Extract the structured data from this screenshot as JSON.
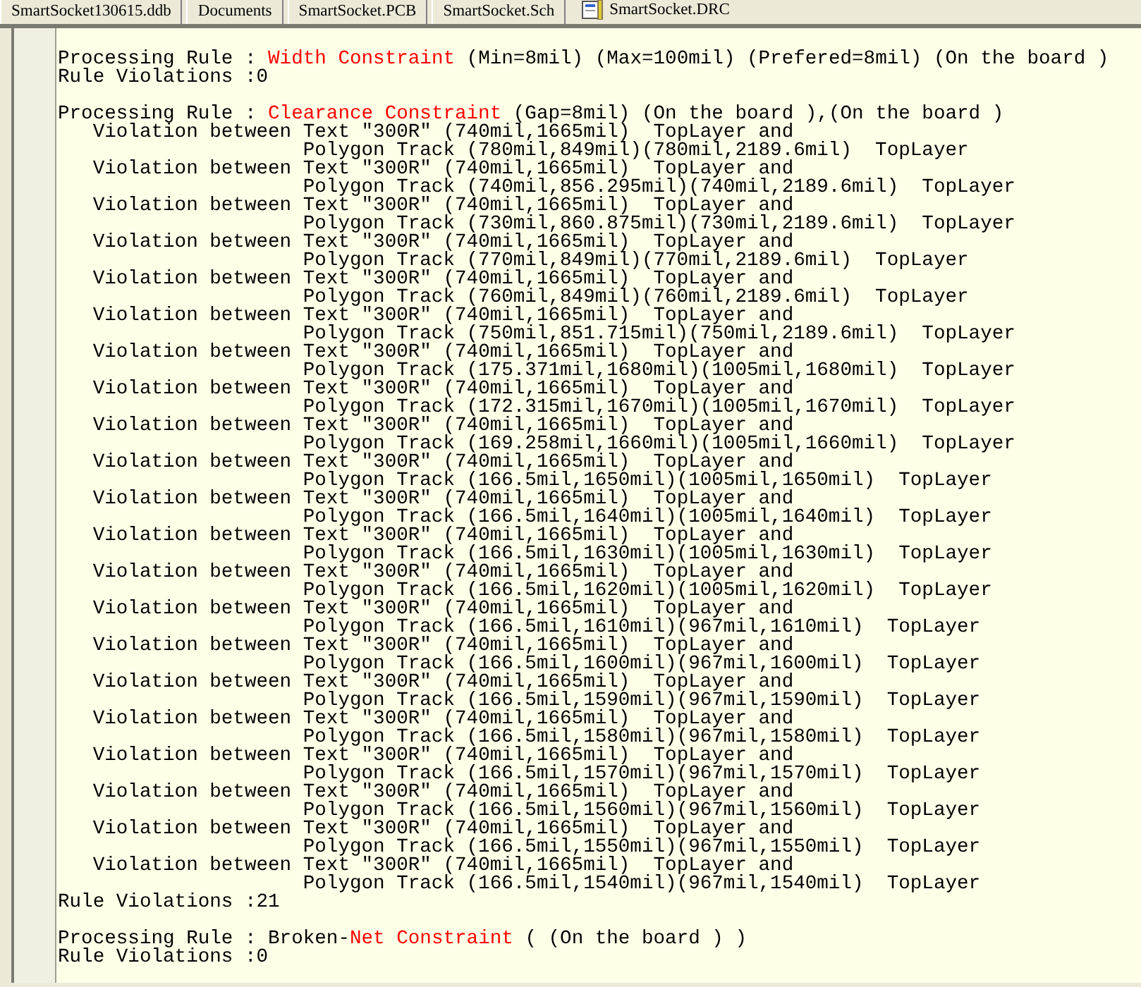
{
  "tabs": [
    {
      "label": "SmartSocket130615.ddb",
      "selected": false
    },
    {
      "label": "Documents",
      "selected": false
    },
    {
      "label": "SmartSocket.PCB",
      "selected": false
    },
    {
      "label": "SmartSocket.Sch",
      "selected": false
    },
    {
      "label": "SmartSocket.DRC",
      "selected": true
    }
  ],
  "report": [
    {
      "label": "Processing Rule : ",
      "constraint": "Width Constraint",
      "params": " (Min=8mil) (Max=100mil) (Prefered=8mil) (On the board )",
      "result": "Rule Violations :0"
    },
    {
      "label": "Processing Rule : ",
      "constraint": "Clearance Constraint",
      "params": " (Gap=8mil) (On the board ),(On the board )",
      "violations": [
        {
          "label": "Violation between",
          "text": "Text \"300R\" (740mil,1665mil)  TopLayer and",
          "polygon": "Polygon Track (780mil,849mil)(780mil,2189.6mil)  TopLayer"
        },
        {
          "label": "Violation between",
          "text": "Text \"300R\" (740mil,1665mil)  TopLayer and",
          "polygon": "Polygon Track (740mil,856.295mil)(740mil,2189.6mil)  TopLayer"
        },
        {
          "label": "Violation between",
          "text": "Text \"300R\" (740mil,1665mil)  TopLayer and",
          "polygon": "Polygon Track (730mil,860.875mil)(730mil,2189.6mil)  TopLayer"
        },
        {
          "label": "Violation between",
          "text": "Text \"300R\" (740mil,1665mil)  TopLayer and",
          "polygon": "Polygon Track (770mil,849mil)(770mil,2189.6mil)  TopLayer"
        },
        {
          "label": "Violation between",
          "text": "Text \"300R\" (740mil,1665mil)  TopLayer and",
          "polygon": "Polygon Track (760mil,849mil)(760mil,2189.6mil)  TopLayer"
        },
        {
          "label": "Violation between",
          "text": "Text \"300R\" (740mil,1665mil)  TopLayer and",
          "polygon": "Polygon Track (750mil,851.715mil)(750mil,2189.6mil)  TopLayer"
        },
        {
          "label": "Violation between",
          "text": "Text \"300R\" (740mil,1665mil)  TopLayer and",
          "polygon": "Polygon Track (175.371mil,1680mil)(1005mil,1680mil)  TopLayer"
        },
        {
          "label": "Violation between",
          "text": "Text \"300R\" (740mil,1665mil)  TopLayer and",
          "polygon": "Polygon Track (172.315mil,1670mil)(1005mil,1670mil)  TopLayer"
        },
        {
          "label": "Violation between",
          "text": "Text \"300R\" (740mil,1665mil)  TopLayer and",
          "polygon": "Polygon Track (169.258mil,1660mil)(1005mil,1660mil)  TopLayer"
        },
        {
          "label": "Violation between",
          "text": "Text \"300R\" (740mil,1665mil)  TopLayer and",
          "polygon": "Polygon Track (166.5mil,1650mil)(1005mil,1650mil)  TopLayer"
        },
        {
          "label": "Violation between",
          "text": "Text \"300R\" (740mil,1665mil)  TopLayer and",
          "polygon": "Polygon Track (166.5mil,1640mil)(1005mil,1640mil)  TopLayer"
        },
        {
          "label": "Violation between",
          "text": "Text \"300R\" (740mil,1665mil)  TopLayer and",
          "polygon": "Polygon Track (166.5mil,1630mil)(1005mil,1630mil)  TopLayer"
        },
        {
          "label": "Violation between",
          "text": "Text \"300R\" (740mil,1665mil)  TopLayer and",
          "polygon": "Polygon Track (166.5mil,1620mil)(1005mil,1620mil)  TopLayer"
        },
        {
          "label": "Violation between",
          "text": "Text \"300R\" (740mil,1665mil)  TopLayer and",
          "polygon": "Polygon Track (166.5mil,1610mil)(967mil,1610mil)  TopLayer"
        },
        {
          "label": "Violation between",
          "text": "Text \"300R\" (740mil,1665mil)  TopLayer and",
          "polygon": "Polygon Track (166.5mil,1600mil)(967mil,1600mil)  TopLayer"
        },
        {
          "label": "Violation between",
          "text": "Text \"300R\" (740mil,1665mil)  TopLayer and",
          "polygon": "Polygon Track (166.5mil,1590mil)(967mil,1590mil)  TopLayer"
        },
        {
          "label": "Violation between",
          "text": "Text \"300R\" (740mil,1665mil)  TopLayer and",
          "polygon": "Polygon Track (166.5mil,1580mil)(967mil,1580mil)  TopLayer"
        },
        {
          "label": "Violation between",
          "text": "Text \"300R\" (740mil,1665mil)  TopLayer and",
          "polygon": "Polygon Track (166.5mil,1570mil)(967mil,1570mil)  TopLayer"
        },
        {
          "label": "Violation between",
          "text": "Text \"300R\" (740mil,1665mil)  TopLayer and",
          "polygon": "Polygon Track (166.5mil,1560mil)(967mil,1560mil)  TopLayer"
        },
        {
          "label": "Violation between",
          "text": "Text \"300R\" (740mil,1665mil)  TopLayer and",
          "polygon": "Polygon Track (166.5mil,1550mil)(967mil,1550mil)  TopLayer"
        },
        {
          "label": "Violation between",
          "text": "Text \"300R\" (740mil,1665mil)  TopLayer and",
          "polygon": "Polygon Track (166.5mil,1540mil)(967mil,1540mil)  TopLayer"
        }
      ],
      "result": "Rule Violations :21"
    },
    {
      "label": "Processing Rule : ",
      "prefix": "Broken-",
      "constraint": "Net Constraint",
      "params": " ( (On the board ) )",
      "result": "Rule Violations :0"
    }
  ]
}
